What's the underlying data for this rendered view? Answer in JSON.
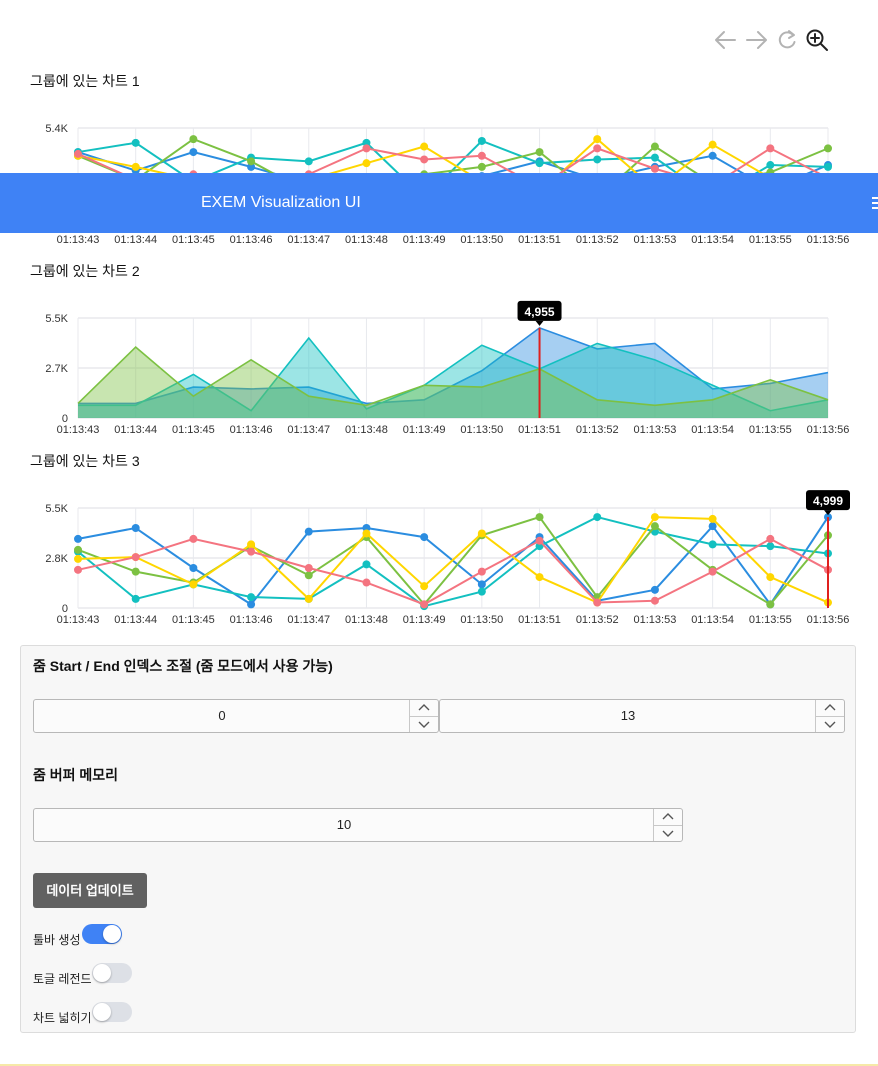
{
  "toolbar": {
    "icons": [
      "arrow-left-icon",
      "arrow-right-icon",
      "refresh-icon",
      "zoom-in-icon"
    ]
  },
  "banner": {
    "title": "EXEM Visualization UI"
  },
  "colors": {
    "blue": "#2b8de0",
    "teal": "#13c0c0",
    "green": "#7cc142",
    "yellow": "#ffd600",
    "red": "#f47480",
    "accent": "#3f82f5"
  },
  "chart_data": [
    {
      "type": "line",
      "title": "그룹에 있는 차트 1",
      "x": [
        "01:13:43",
        "01:13:44",
        "01:13:45",
        "01:13:46",
        "01:13:47",
        "01:13:48",
        "01:13:49",
        "01:13:50",
        "01:13:51",
        "01:13:52",
        "01:13:53",
        "01:13:54",
        "01:13:55",
        "01:13:56"
      ],
      "ylim": [
        0,
        5400
      ],
      "yticks": [
        "5.4K"
      ],
      "series": [
        {
          "color": "blue",
          "values": [
            4100,
            3100,
            4100,
            3300,
            2400,
            1600,
            2400,
            2800,
            3600,
            2600,
            3300,
            3900,
            2100,
            3400
          ]
        },
        {
          "color": "teal",
          "values": [
            4100,
            4600,
            2500,
            3800,
            3600,
            4600,
            1600,
            4700,
            3500,
            3700,
            3800,
            1600,
            3400,
            3300
          ]
        },
        {
          "color": "green",
          "values": [
            3900,
            2600,
            4800,
            3600,
            1900,
            2700,
            2900,
            3300,
            4100,
            1600,
            4400,
            2400,
            3000,
            4300
          ]
        },
        {
          "color": "yellow",
          "values": [
            3900,
            3300,
            2600,
            2700,
            2600,
            3500,
            4400,
            2500,
            1900,
            4800,
            2100,
            4500,
            2700,
            2300
          ]
        },
        {
          "color": "red",
          "values": [
            4000,
            2600,
            2900,
            2600,
            2900,
            4300,
            3700,
            3900,
            2200,
            4300,
            3200,
            2300,
            4300,
            2700
          ]
        }
      ]
    },
    {
      "type": "area",
      "title": "그룹에 있는 차트 2",
      "x": [
        "01:13:43",
        "01:13:44",
        "01:13:45",
        "01:13:46",
        "01:13:47",
        "01:13:48",
        "01:13:49",
        "01:13:50",
        "01:13:51",
        "01:13:52",
        "01:13:53",
        "01:13:54",
        "01:13:55",
        "01:13:56"
      ],
      "ylim": [
        0,
        5500
      ],
      "yticks": [
        "5.5K",
        "2.7K",
        "0"
      ],
      "highlight_index": 8,
      "highlight_label": "4,955",
      "series": [
        {
          "color": "blue",
          "values": [
            800,
            800,
            1700,
            1600,
            1700,
            800,
            1000,
            2600,
            4955,
            3800,
            4100,
            1600,
            1900,
            2500
          ]
        },
        {
          "color": "teal",
          "values": [
            700,
            700,
            2400,
            400,
            4400,
            500,
            1800,
            4000,
            2700,
            4100,
            3200,
            1800,
            400,
            1000
          ]
        },
        {
          "color": "green",
          "values": [
            800,
            3900,
            1200,
            3200,
            1200,
            700,
            1800,
            1700,
            2700,
            1000,
            700,
            1000,
            2100,
            1000
          ]
        }
      ]
    },
    {
      "type": "line",
      "title": "그룹에 있는 차트 3",
      "x": [
        "01:13:43",
        "01:13:44",
        "01:13:45",
        "01:13:46",
        "01:13:47",
        "01:13:48",
        "01:13:49",
        "01:13:50",
        "01:13:51",
        "01:13:52",
        "01:13:53",
        "01:13:54",
        "01:13:55",
        "01:13:56"
      ],
      "ylim": [
        0,
        5500
      ],
      "yticks": [
        "5.5K",
        "2.8K",
        "0"
      ],
      "highlight_index": 13,
      "highlight_label": "4,999",
      "series": [
        {
          "color": "blue",
          "values": [
            3800,
            4400,
            2200,
            200,
            4200,
            4400,
            3900,
            1300,
            3900,
            400,
            1000,
            4500,
            200,
            4999
          ]
        },
        {
          "color": "teal",
          "values": [
            3100,
            500,
            1300,
            600,
            500,
            2400,
            100,
            900,
            3400,
            5000,
            4200,
            3500,
            3400,
            3000
          ]
        },
        {
          "color": "green",
          "values": [
            3200,
            2000,
            1400,
            3400,
            1800,
            3900,
            200,
            4000,
            5000,
            600,
            4500,
            2100,
            200,
            4000
          ]
        },
        {
          "color": "yellow",
          "values": [
            2700,
            2800,
            1300,
            3500,
            500,
            4100,
            1200,
            4100,
            1700,
            300,
            5000,
            4900,
            1700,
            300
          ]
        },
        {
          "color": "red",
          "values": [
            2100,
            2800,
            3800,
            3100,
            2200,
            1400,
            200,
            2000,
            3700,
            300,
            400,
            2000,
            3800,
            2100
          ]
        }
      ]
    }
  ],
  "controls": {
    "zoom_heading": "줌 Start / End 인덱스 조절 (줌 모드에서 사용 가능)",
    "zoom_start": "0",
    "zoom_end": "13",
    "buffer_heading": "줌 버퍼 메모리",
    "buffer_value": "10",
    "update_button": "데이터 업데이트",
    "toggles": [
      {
        "label": "툴바 생성",
        "on": true
      },
      {
        "label": "토글 레전드",
        "on": false
      },
      {
        "label": "차트 넓히기",
        "on": false
      }
    ]
  }
}
